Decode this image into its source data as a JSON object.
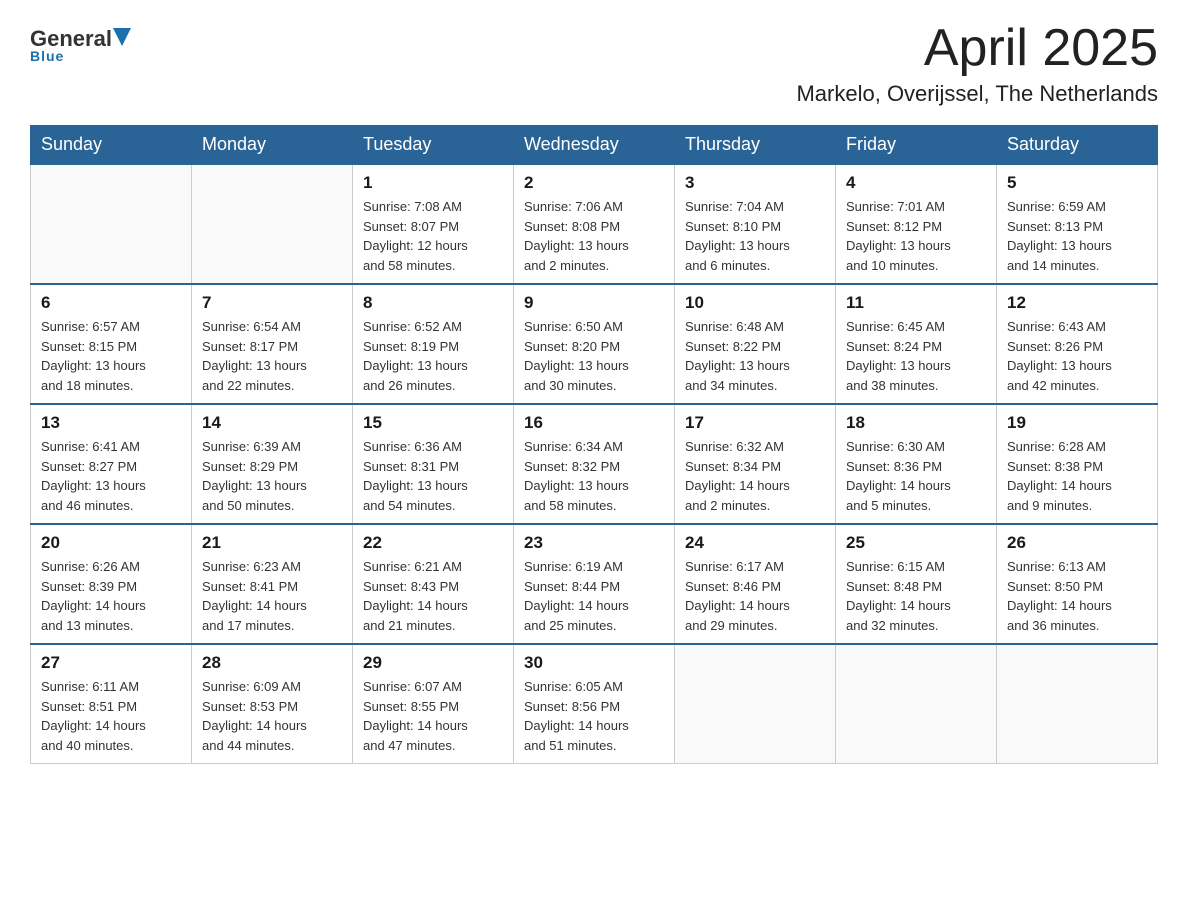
{
  "header": {
    "logo_general": "General",
    "logo_blue": "Blue",
    "month_year": "April 2025",
    "location": "Markelo, Overijssel, The Netherlands"
  },
  "days_of_week": [
    "Sunday",
    "Monday",
    "Tuesday",
    "Wednesday",
    "Thursday",
    "Friday",
    "Saturday"
  ],
  "weeks": [
    [
      {
        "day": "",
        "info": ""
      },
      {
        "day": "",
        "info": ""
      },
      {
        "day": "1",
        "info": "Sunrise: 7:08 AM\nSunset: 8:07 PM\nDaylight: 12 hours\nand 58 minutes."
      },
      {
        "day": "2",
        "info": "Sunrise: 7:06 AM\nSunset: 8:08 PM\nDaylight: 13 hours\nand 2 minutes."
      },
      {
        "day": "3",
        "info": "Sunrise: 7:04 AM\nSunset: 8:10 PM\nDaylight: 13 hours\nand 6 minutes."
      },
      {
        "day": "4",
        "info": "Sunrise: 7:01 AM\nSunset: 8:12 PM\nDaylight: 13 hours\nand 10 minutes."
      },
      {
        "day": "5",
        "info": "Sunrise: 6:59 AM\nSunset: 8:13 PM\nDaylight: 13 hours\nand 14 minutes."
      }
    ],
    [
      {
        "day": "6",
        "info": "Sunrise: 6:57 AM\nSunset: 8:15 PM\nDaylight: 13 hours\nand 18 minutes."
      },
      {
        "day": "7",
        "info": "Sunrise: 6:54 AM\nSunset: 8:17 PM\nDaylight: 13 hours\nand 22 minutes."
      },
      {
        "day": "8",
        "info": "Sunrise: 6:52 AM\nSunset: 8:19 PM\nDaylight: 13 hours\nand 26 minutes."
      },
      {
        "day": "9",
        "info": "Sunrise: 6:50 AM\nSunset: 8:20 PM\nDaylight: 13 hours\nand 30 minutes."
      },
      {
        "day": "10",
        "info": "Sunrise: 6:48 AM\nSunset: 8:22 PM\nDaylight: 13 hours\nand 34 minutes."
      },
      {
        "day": "11",
        "info": "Sunrise: 6:45 AM\nSunset: 8:24 PM\nDaylight: 13 hours\nand 38 minutes."
      },
      {
        "day": "12",
        "info": "Sunrise: 6:43 AM\nSunset: 8:26 PM\nDaylight: 13 hours\nand 42 minutes."
      }
    ],
    [
      {
        "day": "13",
        "info": "Sunrise: 6:41 AM\nSunset: 8:27 PM\nDaylight: 13 hours\nand 46 minutes."
      },
      {
        "day": "14",
        "info": "Sunrise: 6:39 AM\nSunset: 8:29 PM\nDaylight: 13 hours\nand 50 minutes."
      },
      {
        "day": "15",
        "info": "Sunrise: 6:36 AM\nSunset: 8:31 PM\nDaylight: 13 hours\nand 54 minutes."
      },
      {
        "day": "16",
        "info": "Sunrise: 6:34 AM\nSunset: 8:32 PM\nDaylight: 13 hours\nand 58 minutes."
      },
      {
        "day": "17",
        "info": "Sunrise: 6:32 AM\nSunset: 8:34 PM\nDaylight: 14 hours\nand 2 minutes."
      },
      {
        "day": "18",
        "info": "Sunrise: 6:30 AM\nSunset: 8:36 PM\nDaylight: 14 hours\nand 5 minutes."
      },
      {
        "day": "19",
        "info": "Sunrise: 6:28 AM\nSunset: 8:38 PM\nDaylight: 14 hours\nand 9 minutes."
      }
    ],
    [
      {
        "day": "20",
        "info": "Sunrise: 6:26 AM\nSunset: 8:39 PM\nDaylight: 14 hours\nand 13 minutes."
      },
      {
        "day": "21",
        "info": "Sunrise: 6:23 AM\nSunset: 8:41 PM\nDaylight: 14 hours\nand 17 minutes."
      },
      {
        "day": "22",
        "info": "Sunrise: 6:21 AM\nSunset: 8:43 PM\nDaylight: 14 hours\nand 21 minutes."
      },
      {
        "day": "23",
        "info": "Sunrise: 6:19 AM\nSunset: 8:44 PM\nDaylight: 14 hours\nand 25 minutes."
      },
      {
        "day": "24",
        "info": "Sunrise: 6:17 AM\nSunset: 8:46 PM\nDaylight: 14 hours\nand 29 minutes."
      },
      {
        "day": "25",
        "info": "Sunrise: 6:15 AM\nSunset: 8:48 PM\nDaylight: 14 hours\nand 32 minutes."
      },
      {
        "day": "26",
        "info": "Sunrise: 6:13 AM\nSunset: 8:50 PM\nDaylight: 14 hours\nand 36 minutes."
      }
    ],
    [
      {
        "day": "27",
        "info": "Sunrise: 6:11 AM\nSunset: 8:51 PM\nDaylight: 14 hours\nand 40 minutes."
      },
      {
        "day": "28",
        "info": "Sunrise: 6:09 AM\nSunset: 8:53 PM\nDaylight: 14 hours\nand 44 minutes."
      },
      {
        "day": "29",
        "info": "Sunrise: 6:07 AM\nSunset: 8:55 PM\nDaylight: 14 hours\nand 47 minutes."
      },
      {
        "day": "30",
        "info": "Sunrise: 6:05 AM\nSunset: 8:56 PM\nDaylight: 14 hours\nand 51 minutes."
      },
      {
        "day": "",
        "info": ""
      },
      {
        "day": "",
        "info": ""
      },
      {
        "day": "",
        "info": ""
      }
    ]
  ]
}
